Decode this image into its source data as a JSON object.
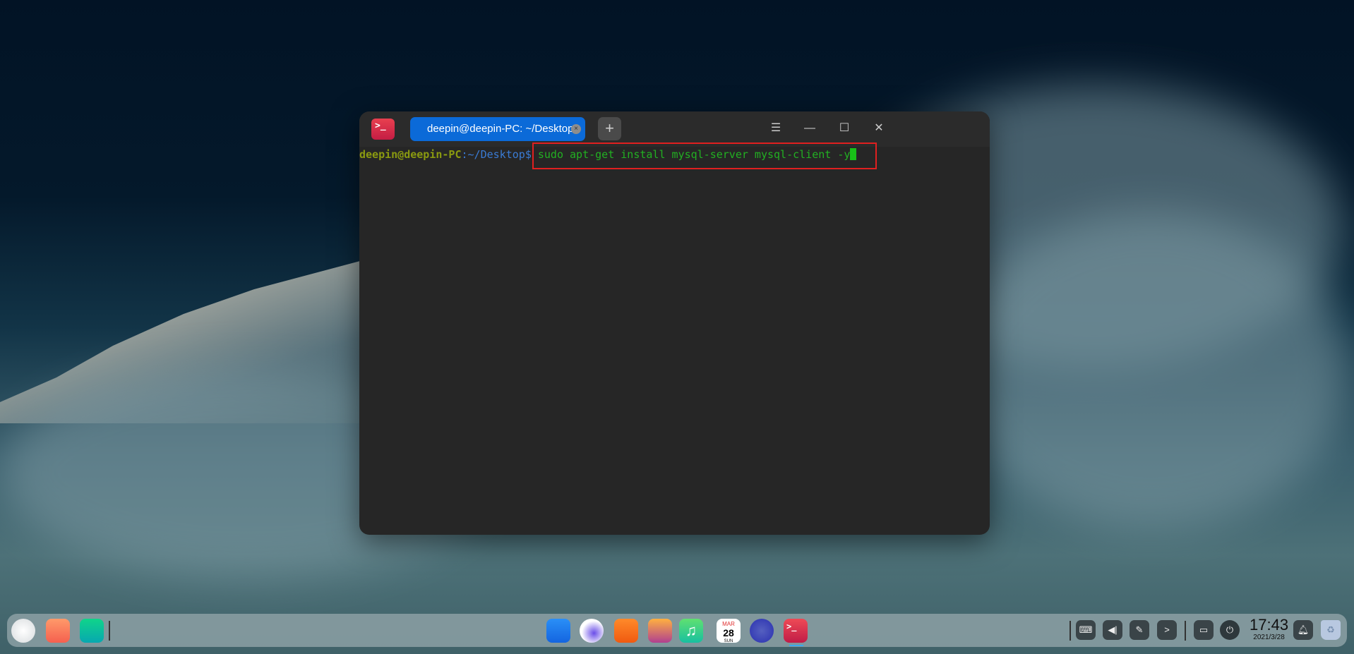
{
  "terminal": {
    "app_icon": ">_",
    "tab_title": "deepin@deepin-PC: ~/Desktop",
    "tab_close": "×",
    "new_tab": "+",
    "menu": "☰",
    "minimize": "—",
    "maximize": "☐",
    "close": "✕",
    "prompt_user": "deepin@deepin-PC",
    "prompt_sep": ":",
    "prompt_path": "~/Desktop",
    "prompt_dollar": "$",
    "command": " sudo apt-get install mysql-server mysql-client -y"
  },
  "dock": {
    "calendar_month": "MAR",
    "calendar_day": "28",
    "calendar_weekday": "SUN",
    "terminal_icon": ">_"
  },
  "tray": {
    "time": "17:43",
    "date": "2021/3/28",
    "arrow": ">"
  },
  "colors": {
    "accent": "#0b6ad8",
    "highlight": "#e02020"
  }
}
